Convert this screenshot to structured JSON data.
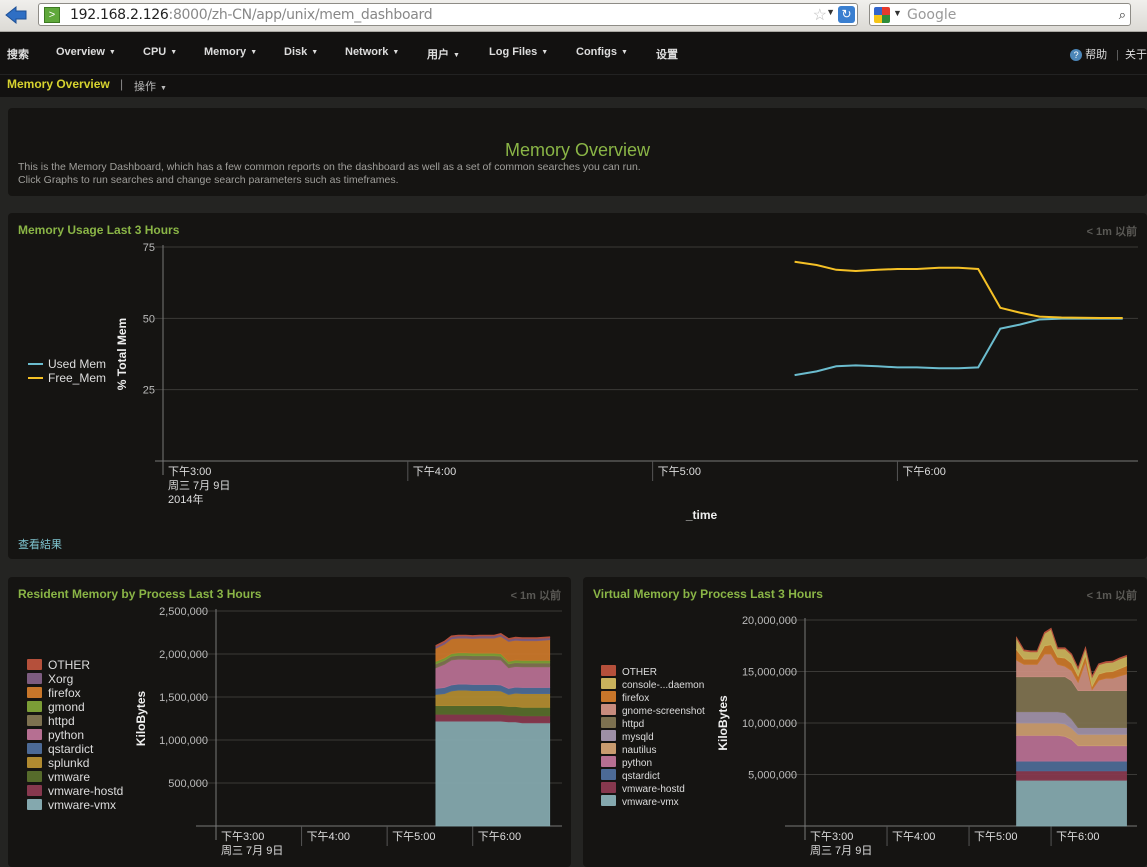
{
  "browser": {
    "url_host": "192.168.2.126",
    "url_path": ":8000/zh-CN/app/unix/mem_dashboard",
    "search_placeholder": "Google"
  },
  "nav": {
    "items": [
      {
        "label": "搜索",
        "dropdown": false
      },
      {
        "label": "Overview",
        "dropdown": true
      },
      {
        "label": "CPU",
        "dropdown": true
      },
      {
        "label": "Memory",
        "dropdown": true
      },
      {
        "label": "Disk",
        "dropdown": true
      },
      {
        "label": "Network",
        "dropdown": true
      },
      {
        "label": "用户",
        "dropdown": true
      },
      {
        "label": "Log Files",
        "dropdown": true
      },
      {
        "label": "Configs",
        "dropdown": true
      },
      {
        "label": "设置",
        "dropdown": false
      }
    ],
    "help_label": "帮助",
    "about_label": "关于"
  },
  "subnav": {
    "title": "Memory Overview",
    "separator": "|",
    "actions_label": "操作"
  },
  "intro": {
    "title": "Memory Overview",
    "line1": "This is the Memory Dashboard, which has a few common reports on the dashboard as well as a set of common searches you can run.",
    "line2": "Click Graphs to run searches and change search parameters such as timeframes."
  },
  "panels": {
    "usage": {
      "title": "Memory Usage Last 3 Hours",
      "age": "< 1m 以前",
      "view_results": "查看結果"
    },
    "resident": {
      "title": "Resident Memory by Process Last 3 Hours",
      "age": "< 1m 以前"
    },
    "virtual": {
      "title": "Virtual Memory by Process Last 3 Hours",
      "age": "< 1m 以前"
    }
  },
  "chart_data": [
    {
      "type": "line",
      "title": "Memory Usage Last 3 Hours",
      "xlabel": "_time",
      "ylabel": "% Total Mem",
      "ylim": [
        0,
        75
      ],
      "yticks": [
        25,
        50,
        75
      ],
      "xticks": [
        "下午3:00",
        "下午4:00",
        "下午5:00",
        "下午6:00"
      ],
      "xtick_sub": [
        "周三 7月 9日",
        "2014年"
      ],
      "x_range_hours": [
        15.0,
        18.95
      ],
      "x": [
        17.58,
        17.67,
        17.75,
        17.83,
        17.92,
        18.0,
        18.08,
        18.17,
        18.25,
        18.33,
        18.42,
        18.5,
        18.58,
        18.67,
        18.75,
        18.83,
        18.92
      ],
      "legend": "left",
      "series": [
        {
          "name": "Used Mem",
          "color": "#6bbcce",
          "values": [
            30.1,
            31.4,
            33.2,
            33.5,
            33.2,
            32.8,
            32.8,
            32.5,
            32.5,
            32.8,
            46.4,
            47.8,
            49.6,
            49.9,
            49.9,
            49.9,
            49.9
          ]
        },
        {
          "name": "Free_Mem",
          "color": "#f5c126",
          "values": [
            69.8,
            68.7,
            67.0,
            66.6,
            67.0,
            67.3,
            67.3,
            67.7,
            67.7,
            67.3,
            53.7,
            52.0,
            50.6,
            50.3,
            50.2,
            50.1,
            50.1
          ]
        }
      ]
    },
    {
      "type": "area",
      "stacked": true,
      "title": "Resident Memory by Process Last 3 Hours",
      "ylabel": "KiloBytes",
      "ylim": [
        0,
        2500000
      ],
      "yticks": [
        500000,
        1000000,
        1500000,
        2000000,
        2500000
      ],
      "ytick_labels": [
        "500,000",
        "1,000,000",
        "1,500,000",
        "2,000,000",
        "2,500,000"
      ],
      "xticks": [
        "下午3:00",
        "下午4:00",
        "下午5:00",
        "下午6:00"
      ],
      "xtick_sub": [
        "周三 7月 9日"
      ],
      "x_range_hours": [
        15.0,
        18.95
      ],
      "x": [
        17.57,
        17.67,
        17.75,
        17.83,
        17.92,
        18.0,
        18.08,
        18.17,
        18.25,
        18.33,
        18.42,
        18.5,
        18.58,
        18.67,
        18.75,
        18.9
      ],
      "legend": "left",
      "series": [
        {
          "name": "vmware-vmx",
          "color": "#84a8ae",
          "values": [
            1220000,
            1220000,
            1220000,
            1220000,
            1220000,
            1220000,
            1220000,
            1220000,
            1220000,
            1220000,
            1210000,
            1210000,
            1200000,
            1200000,
            1200000,
            1200000
          ]
        },
        {
          "name": "vmware-hostd",
          "color": "#86384e",
          "values": [
            80000,
            80000,
            80000,
            80000,
            80000,
            80000,
            80000,
            80000,
            80000,
            80000,
            80000,
            80000,
            80000,
            80000,
            80000,
            80000
          ]
        },
        {
          "name": "vmware",
          "color": "#566b2b",
          "values": [
            100000,
            100000,
            100000,
            100000,
            100000,
            100000,
            100000,
            100000,
            100000,
            100000,
            100000,
            100000,
            100000,
            100000,
            100000,
            100000
          ]
        },
        {
          "name": "splunkd",
          "color": "#b08a30",
          "values": [
            130000,
            140000,
            170000,
            180000,
            180000,
            175000,
            175000,
            175000,
            175000,
            170000,
            140000,
            155000,
            160000,
            160000,
            160000,
            160000
          ]
        },
        {
          "name": "qstardict",
          "color": "#4c6a96",
          "values": [
            70000,
            70000,
            70000,
            70000,
            70000,
            70000,
            70000,
            70000,
            70000,
            70000,
            70000,
            70000,
            70000,
            70000,
            70000,
            70000
          ]
        },
        {
          "name": "python",
          "color": "#b66f92",
          "values": [
            240000,
            270000,
            290000,
            290000,
            290000,
            290000,
            290000,
            290000,
            290000,
            290000,
            240000,
            240000,
            240000,
            240000,
            240000,
            240000
          ]
        },
        {
          "name": "httpd",
          "color": "#7d7150",
          "values": [
            45000,
            45000,
            45000,
            45000,
            45000,
            45000,
            45000,
            45000,
            45000,
            45000,
            45000,
            45000,
            45000,
            45000,
            45000,
            45000
          ]
        },
        {
          "name": "gmond",
          "color": "#7b9d36",
          "values": [
            30000,
            30000,
            30000,
            30000,
            30000,
            30000,
            30000,
            30000,
            30000,
            30000,
            30000,
            30000,
            30000,
            30000,
            30000,
            30000
          ]
        },
        {
          "name": "firefox",
          "color": "#c8762a",
          "values": [
            150000,
            160000,
            170000,
            170000,
            170000,
            170000,
            175000,
            175000,
            175000,
            200000,
            230000,
            230000,
            230000,
            230000,
            230000,
            240000
          ]
        },
        {
          "name": "Xorg",
          "color": "#7d5c80",
          "values": [
            25000,
            25000,
            25000,
            25000,
            25000,
            25000,
            25000,
            25000,
            25000,
            25000,
            25000,
            25000,
            25000,
            25000,
            25000,
            25000
          ]
        },
        {
          "name": "OTHER",
          "color": "#b5503b",
          "values": [
            10000,
            10000,
            10000,
            10000,
            10000,
            10000,
            10000,
            10000,
            10000,
            10000,
            10000,
            10000,
            10000,
            10000,
            10000,
            10000
          ]
        }
      ]
    },
    {
      "type": "area",
      "stacked": true,
      "title": "Virtual Memory by Process Last 3 Hours",
      "ylabel": "KiloBytes",
      "ylim": [
        0,
        20000000
      ],
      "yticks": [
        5000000,
        10000000,
        15000000,
        20000000
      ],
      "ytick_labels": [
        "5,000,000",
        "10,000,000",
        "15,000,000",
        "20,000,000"
      ],
      "xticks": [
        "下午3:00",
        "下午4:00",
        "下午5:00",
        "下午6:00"
      ],
      "xtick_sub": [
        "周三 7月 9日"
      ],
      "x_range_hours": [
        15.0,
        18.95
      ],
      "x": [
        17.58,
        17.67,
        17.75,
        17.83,
        17.92,
        18.0,
        18.08,
        18.17,
        18.25,
        18.33,
        18.42,
        18.5,
        18.58,
        18.67,
        18.75,
        18.83,
        18.92
      ],
      "legend": "left",
      "series": [
        {
          "name": "vmware-vmx",
          "color": "#84a8ae",
          "values": [
            4450000,
            4450000,
            4450000,
            4450000,
            4450000,
            4450000,
            4450000,
            4450000,
            4450000,
            4450000,
            4450000,
            4450000,
            4450000,
            4450000,
            4450000,
            4450000,
            4450000
          ]
        },
        {
          "name": "vmware-hostd",
          "color": "#86384e",
          "values": [
            900000,
            900000,
            900000,
            900000,
            900000,
            900000,
            900000,
            900000,
            900000,
            900000,
            900000,
            900000,
            900000,
            900000,
            900000,
            900000,
            900000
          ]
        },
        {
          "name": "qstardict",
          "color": "#4c6a96",
          "values": [
            950000,
            950000,
            950000,
            950000,
            950000,
            950000,
            950000,
            950000,
            950000,
            950000,
            950000,
            950000,
            950000,
            950000,
            950000,
            950000,
            950000
          ]
        },
        {
          "name": "python",
          "color": "#b66f92",
          "values": [
            2500000,
            2500000,
            2500000,
            2500000,
            2500000,
            2500000,
            2500000,
            2400000,
            2100000,
            1500000,
            1500000,
            1500000,
            1500000,
            1500000,
            1500000,
            1500000,
            1500000
          ]
        },
        {
          "name": "nautilus",
          "color": "#c99b6f",
          "values": [
            1200000,
            1200000,
            1200000,
            1200000,
            1200000,
            1200000,
            1200000,
            1200000,
            1100000,
            1100000,
            1100000,
            1100000,
            1100000,
            1100000,
            1100000,
            1100000,
            1100000
          ]
        },
        {
          "name": "mysqld",
          "color": "#9e8fa6",
          "values": [
            1100000,
            1100000,
            1100000,
            1100000,
            1100000,
            1100000,
            1100000,
            1100000,
            900000,
            650000,
            650000,
            650000,
            650000,
            650000,
            650000,
            650000,
            650000
          ]
        },
        {
          "name": "httpd",
          "color": "#7d7150",
          "values": [
            3400000,
            3400000,
            3400000,
            3400000,
            3400000,
            3400000,
            3400000,
            3500000,
            3700000,
            3600000,
            3600000,
            3600000,
            3600000,
            3600000,
            3600000,
            3600000,
            3600000
          ]
        },
        {
          "name": "gnome-screenshot",
          "color": "#c88c7e",
          "values": [
            1600000,
            1200000,
            1200000,
            1200000,
            2200000,
            2200000,
            1200000,
            1000000,
            1000000,
            800000,
            2800000,
            100000,
            1000000,
            1200000,
            1200000,
            1400000,
            1600000
          ]
        },
        {
          "name": "firefox",
          "color": "#c8762a",
          "values": [
            1000000,
            500000,
            500000,
            500000,
            800000,
            900000,
            700000,
            800000,
            700000,
            600000,
            600000,
            300000,
            600000,
            600000,
            650000,
            700000,
            800000
          ]
        },
        {
          "name": "console-...daemon",
          "color": "#c9b25c",
          "values": [
            1100000,
            800000,
            700000,
            700000,
            1200000,
            1500000,
            800000,
            900000,
            800000,
            700000,
            700000,
            900000,
            900000,
            900000,
            900000,
            950000,
            900000
          ]
        },
        {
          "name": "OTHER",
          "color": "#b5503b",
          "values": [
            100000,
            100000,
            100000,
            100000,
            100000,
            100000,
            100000,
            100000,
            100000,
            100000,
            100000,
            100000,
            100000,
            100000,
            100000,
            100000,
            100000
          ]
        }
      ]
    }
  ]
}
